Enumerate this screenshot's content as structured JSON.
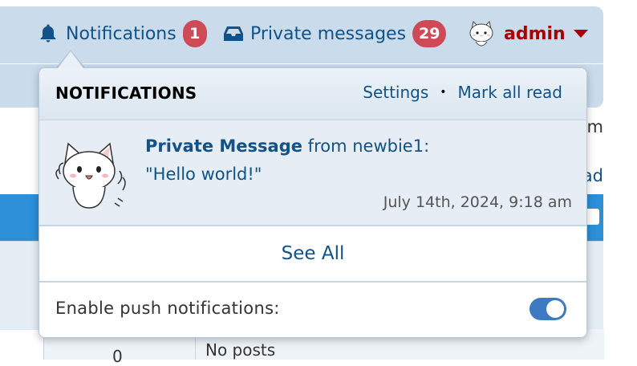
{
  "nav": {
    "notifications_label": "Notifications",
    "notifications_count": "1",
    "messages_label": "Private messages",
    "messages_count": "29",
    "username": "admin"
  },
  "background": {
    "fragment_1": "m",
    "fragment_2": "ad",
    "cell_number": "0",
    "cell_text": "No posts"
  },
  "dropdown": {
    "title": "NOTIFICATIONS",
    "settings_label": "Settings",
    "separator": "•",
    "mark_all_read_label": "Mark all read",
    "item": {
      "type": "Private Message",
      "from_text": "from newbie1:",
      "message": "\"Hello world!\"",
      "time": "July 14th, 2024, 9:18 am"
    },
    "see_all_label": "See All",
    "push_label": "Enable push notifications:",
    "push_enabled": true
  },
  "colors": {
    "link": "#105289",
    "badge": "#cf4a57",
    "username": "#aa0000",
    "toggle": "#3c7ac2"
  }
}
